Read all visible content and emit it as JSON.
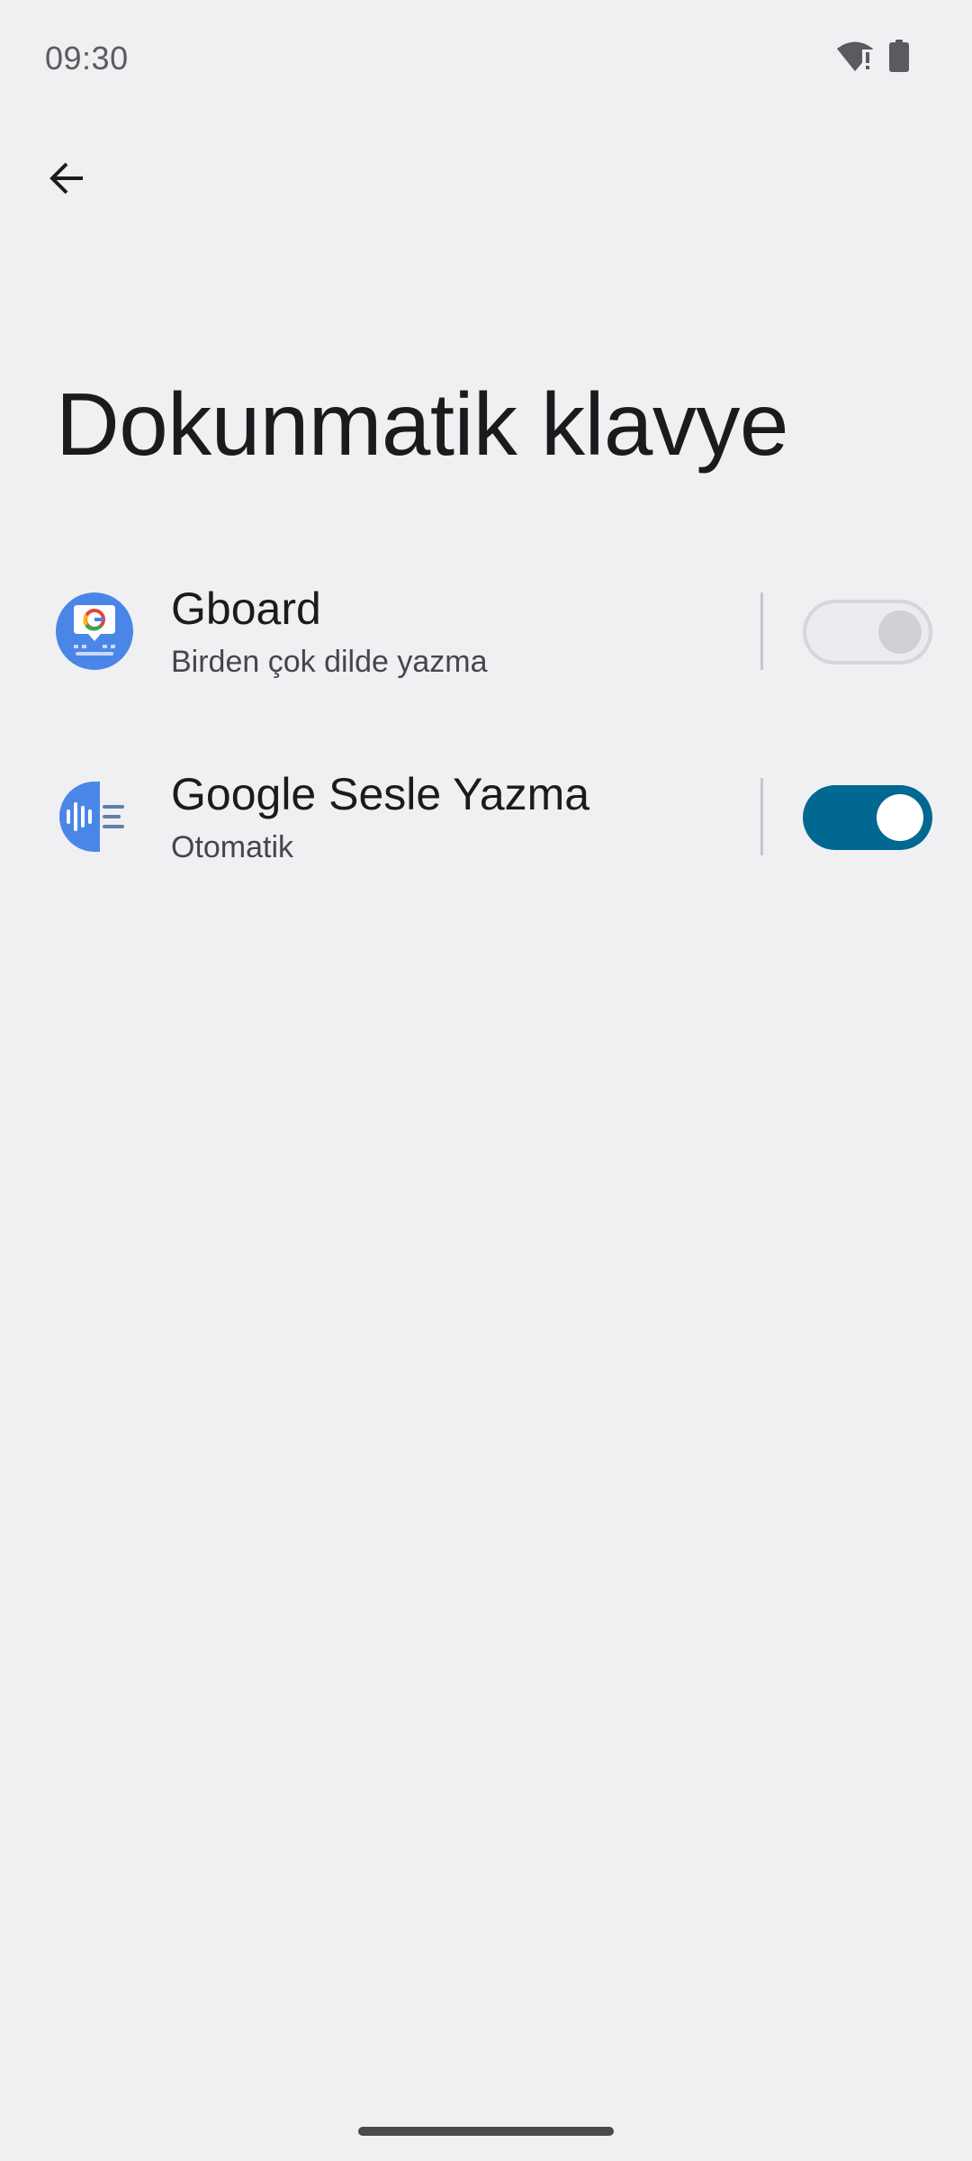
{
  "status_bar": {
    "time": "09:30",
    "icons": [
      "wifi-alert-icon",
      "battery-icon"
    ]
  },
  "header": {
    "back_icon": "arrow-back-icon"
  },
  "page": {
    "title": "Dokunmatik klavye"
  },
  "keyboards": [
    {
      "name": "Gboard",
      "subtitle": "Birden çok dilde yazma",
      "icon": "gboard-icon",
      "enabled": false
    },
    {
      "name": "Google Sesle Yazma",
      "subtitle": "Otomatik",
      "icon": "voice-typing-icon",
      "enabled": true
    }
  ],
  "colors": {
    "background": "#f0f0f3",
    "toggle_on": "#006891",
    "gboard_blue": "#4a86e8",
    "voice_blue": "#4a86e8"
  }
}
